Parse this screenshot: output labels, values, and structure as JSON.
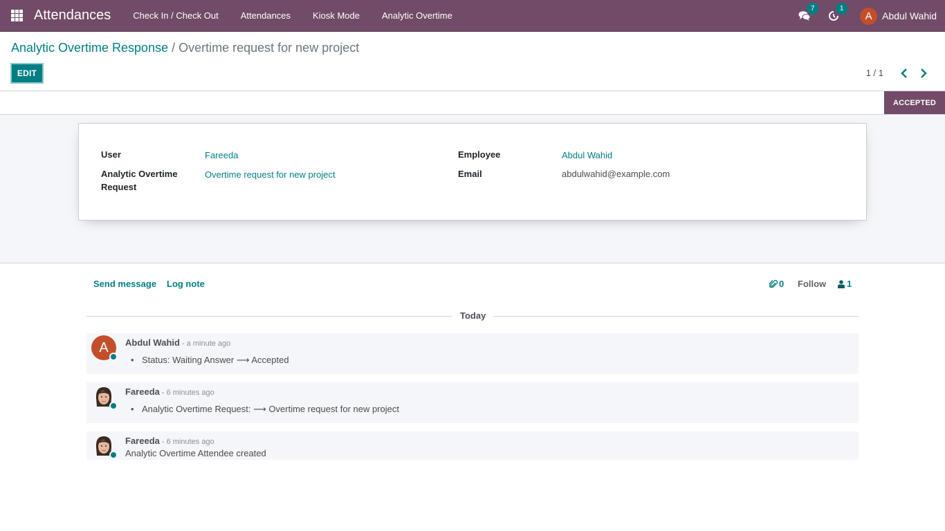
{
  "navbar": {
    "app_name": "Attendances",
    "menu": [
      "Check In / Check Out",
      "Attendances",
      "Kiosk Mode",
      "Analytic Overtime"
    ],
    "messages_count": "7",
    "activities_count": "1",
    "user_initial": "A",
    "user_name": "Abdul Wahid"
  },
  "breadcrumb": {
    "parent": "Analytic Overtime Response",
    "separator": " / ",
    "current": "Overtime request for new project"
  },
  "control_panel": {
    "edit_label": "EDIT",
    "pager": "1 / 1"
  },
  "statusbar": {
    "current_status": "ACCEPTED"
  },
  "form": {
    "left": [
      {
        "label": "User",
        "value": "Fareeda",
        "is_link": true
      },
      {
        "label": "Analytic Overtime Request",
        "value": "Overtime request for new project",
        "is_link": true
      }
    ],
    "right": [
      {
        "label": "Employee",
        "value": "Abdul Wahid",
        "is_link": true
      },
      {
        "label": "Email",
        "value": "abdulwahid@example.com",
        "is_link": false
      }
    ]
  },
  "chatter": {
    "send_message": "Send message",
    "log_note": "Log note",
    "attachments_count": "0",
    "follow_label": "Follow",
    "followers_count": "1",
    "date_separator": "Today",
    "messages": [
      {
        "author": "Abdul Wahid",
        "date": "- a minute ago",
        "avatar_initial": "A",
        "tracking": {
          "field": "Status:",
          "old": "Waiting Answer",
          "arrow": "⟶",
          "new": "Accepted"
        }
      },
      {
        "author": "Fareeda",
        "date": "- 6 minutes ago",
        "tracking": {
          "field": "Analytic Overtime Request:",
          "old": "",
          "arrow": "⟶",
          "new": "Overtime request for new project"
        }
      },
      {
        "author": "Fareeda",
        "date": "- 6 minutes ago",
        "body": "Analytic Overtime Attendee created"
      }
    ]
  },
  "colors": {
    "brand": "#714b67",
    "accent": "#017e84",
    "avatar_orange": "#c24f2b"
  }
}
